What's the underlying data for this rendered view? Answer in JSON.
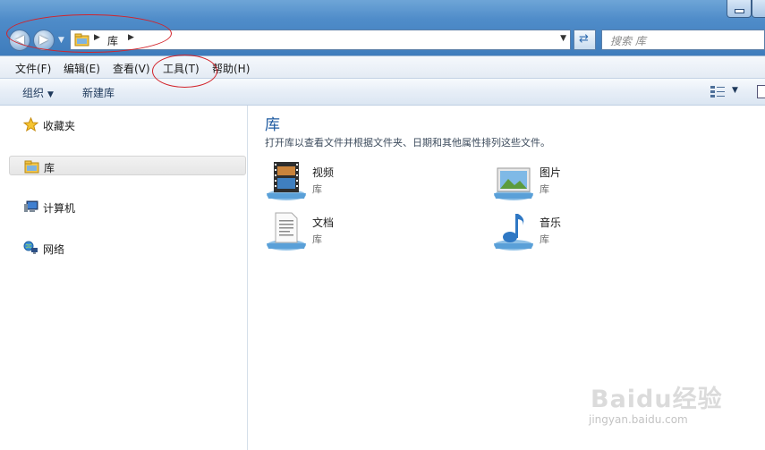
{
  "address": {
    "location": "库"
  },
  "search": {
    "placeholder": "搜索 库"
  },
  "menu": [
    "文件(F)",
    "编辑(E)",
    "查看(V)",
    "工具(T)",
    "帮助(H)"
  ],
  "toolbar": {
    "organize": "组织",
    "new_library": "新建库"
  },
  "sidebar": {
    "items": [
      {
        "label": "收藏夹",
        "icon": "star-icon"
      },
      {
        "label": "库",
        "icon": "library-icon",
        "selected": true
      },
      {
        "label": "计算机",
        "icon": "computer-icon"
      },
      {
        "label": "网络",
        "icon": "network-icon"
      }
    ]
  },
  "main": {
    "title": "库",
    "description": "打开库以查看文件并根据文件夹、日期和其他属性排列这些文件。",
    "libraries": [
      {
        "name": "视频",
        "type": "库",
        "icon": "video-library-icon"
      },
      {
        "name": "图片",
        "type": "库",
        "icon": "pictures-library-icon"
      },
      {
        "name": "文档",
        "type": "库",
        "icon": "documents-library-icon"
      },
      {
        "name": "音乐",
        "type": "库",
        "icon": "music-library-icon"
      }
    ]
  },
  "watermark": {
    "text": "Baidu经验",
    "url": "jingyan.baidu.com"
  }
}
